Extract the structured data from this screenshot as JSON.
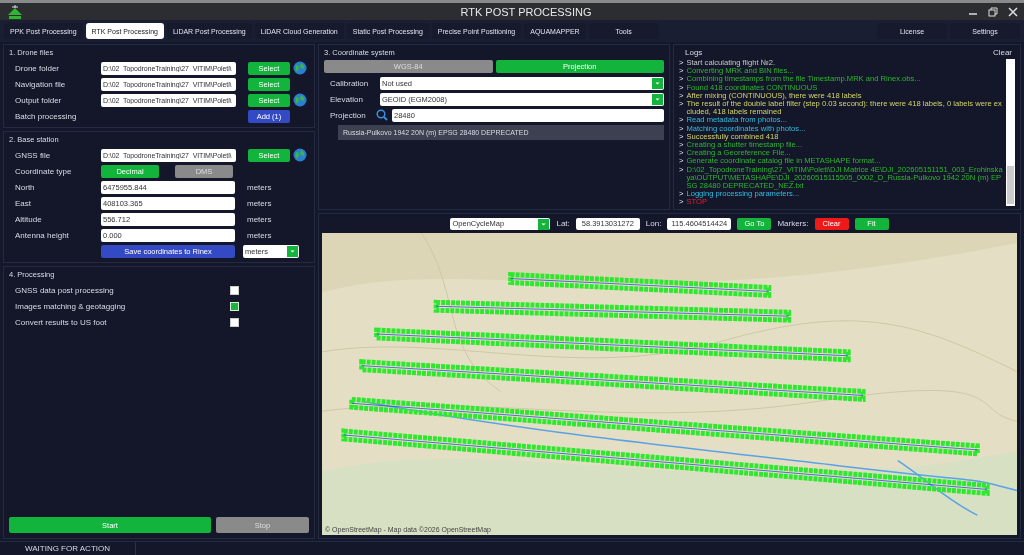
{
  "window": {
    "title": "RTK POST PROCESSING"
  },
  "tabs": [
    {
      "label": "PPK Post Processing",
      "selected": false
    },
    {
      "label": "RTK Post Processing",
      "selected": true
    },
    {
      "label": "LiDAR Post Processing",
      "selected": false
    },
    {
      "label": "LiDAR Cloud Generation",
      "selected": false
    },
    {
      "label": "Static Post Processing",
      "selected": false
    },
    {
      "label": "Precise Point Positioning",
      "selected": false
    },
    {
      "label": "AQUAMAPPER",
      "selected": false
    },
    {
      "label": "Tools",
      "selected": false
    }
  ],
  "top_buttons": [
    "License",
    "Settings"
  ],
  "drone_files": {
    "title": "1. Drone files",
    "rows": [
      {
        "label": "Drone folder",
        "value": "D:\\02_TopodroneTraining\\27_VITIM\\Poleti\\",
        "button": "Select",
        "globe": true
      },
      {
        "label": "Navigation file",
        "value": "D:\\02_TopodroneTraining\\27_VITIM\\Poleti\\",
        "button": "Select",
        "globe": false
      },
      {
        "label": "Output folder",
        "value": "D:\\02_TopodroneTraining\\27_VITIM\\Poleti\\",
        "button": "Select",
        "globe": true
      }
    ],
    "batch": {
      "label": "Batch processing",
      "button": "Add (1)"
    }
  },
  "base_station": {
    "title": "2. Base station",
    "gnss": {
      "label": "GNSS file",
      "value": "D:\\02_TopodroneTraining\\27_VITIM\\Poleti\\",
      "button": "Select",
      "globe": true
    },
    "coordinate_type": {
      "label": "Coordinate type",
      "options": [
        {
          "label": "Decimal",
          "selected": true
        },
        {
          "label": "DMS",
          "selected": false
        }
      ]
    },
    "fields": [
      {
        "label": "North",
        "value": "6475955.844",
        "unit": "meters"
      },
      {
        "label": "East",
        "value": "408103.365",
        "unit": "meters"
      },
      {
        "label": "Altitude",
        "value": "556.712",
        "unit": "meters"
      },
      {
        "label": "Antenna height",
        "value": "0.000",
        "unit": "meters"
      }
    ],
    "save_button": "Save coordinates to Rinex",
    "unit_select": "meters"
  },
  "processing": {
    "title": "4. Processing",
    "options": [
      {
        "label": "GNSS data post processing",
        "checked": false
      },
      {
        "label": "Images matching & geotagging",
        "checked": true
      },
      {
        "label": "Convert results to US foot",
        "checked": false
      }
    ],
    "start": {
      "label": "Start",
      "disabled": false
    },
    "stop": {
      "label": "Stop",
      "disabled": true
    }
  },
  "coordinate_system": {
    "title": "3. Coordinate system",
    "modes": [
      {
        "label": "WGS-84",
        "selected": false
      },
      {
        "label": "Projection",
        "selected": true
      }
    ],
    "rows": [
      {
        "kind": "dropdown",
        "label": "Calibration",
        "value": "Not used"
      },
      {
        "kind": "dropdown",
        "label": "Elevation",
        "value": "GEOID (EGM2008)"
      },
      {
        "kind": "search",
        "label": "Projection",
        "value": "28480"
      }
    ],
    "result": "Russia-Pulkovo 1942 20N (m) EPSG 28480 DEPRECATED"
  },
  "logs": {
    "title": "Logs",
    "clear": "Clear",
    "lines": [
      {
        "prompt": ">",
        "text": "Start calculating flight №2.",
        "kind": "plain"
      },
      {
        "prompt": ">",
        "text": "Converting MRK and BIN files...",
        "kind": "success"
      },
      {
        "prompt": ">",
        "text": "Combining timestamps from the file Timestamp.MRK and Rinex.obs...",
        "kind": "success"
      },
      {
        "prompt": ">",
        "text": "Found 418 coordinates CONTINUOUS",
        "kind": "success"
      },
      {
        "prompt": ">",
        "text": "After mixing (CONTINUOUS), there were 418 labels",
        "kind": "warning"
      },
      {
        "prompt": ">",
        "text": "The result of the double label filter (step 0.03 second): there were 418 labels, 0 labels were excluded, 418 labels remained",
        "kind": "warning"
      },
      {
        "prompt": ">",
        "text": "Read metadata from photos...",
        "kind": "info"
      },
      {
        "prompt": ">",
        "text": "Matching coordinates with photos...",
        "kind": "info"
      },
      {
        "prompt": ">",
        "text": "Successfully combined 418",
        "kind": "warning"
      },
      {
        "prompt": ">",
        "text": "Creating a shutter timestamp file...",
        "kind": "success"
      },
      {
        "prompt": ">",
        "text": "Creating a Georeference File...",
        "kind": "success"
      },
      {
        "prompt": ">",
        "text": "Generate coordinate catalog file in METASHAPE format...",
        "kind": "success"
      },
      {
        "prompt": ">",
        "text": "D:\\02_TopodroneTraining\\27_VITIM\\Poleti\\DJI Matrice 4E\\DJI_202605151151_003_Erohinskaya\\OUTPUT\\METASHAPE\\DJI_20260515115505_0002_D_Russia-Pulkovo 1942 20N (m) EPSG 28480 DEPRECATED_NEZ.txt",
        "kind": "success"
      },
      {
        "prompt": ">",
        "text": "Logging processing parameters...",
        "kind": "info"
      },
      {
        "prompt": ">",
        "text": "STOP",
        "kind": "error"
      }
    ]
  },
  "map": {
    "layer": "OpenCycleMap",
    "lat_label": "Lat:",
    "lat": "58.3913031272",
    "lon_label": "Lon:",
    "lon": "115.4604514424",
    "go_to": "Go To",
    "markers_label": "Markers:",
    "clear": "Clear",
    "fit": "Fit",
    "attribution": "© OpenStreetMap - Map data ©2026 OpenStreetMap"
  },
  "status_bar": {
    "text": "WAITING FOR ACTION"
  }
}
